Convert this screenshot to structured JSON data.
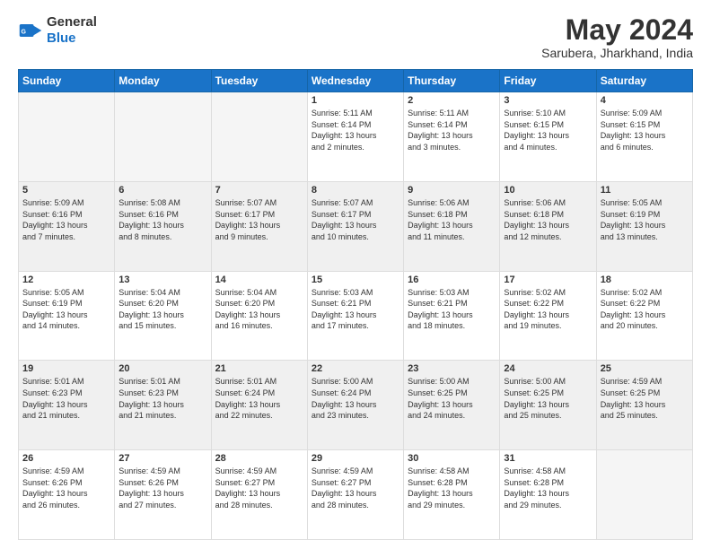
{
  "header": {
    "logo_general": "General",
    "logo_blue": "Blue",
    "month_year": "May 2024",
    "location": "Sarubera, Jharkhand, India"
  },
  "days_of_week": [
    "Sunday",
    "Monday",
    "Tuesday",
    "Wednesday",
    "Thursday",
    "Friday",
    "Saturday"
  ],
  "weeks": [
    [
      {
        "day": "",
        "info": ""
      },
      {
        "day": "",
        "info": ""
      },
      {
        "day": "",
        "info": ""
      },
      {
        "day": "1",
        "info": "Sunrise: 5:11 AM\nSunset: 6:14 PM\nDaylight: 13 hours\nand 2 minutes."
      },
      {
        "day": "2",
        "info": "Sunrise: 5:11 AM\nSunset: 6:14 PM\nDaylight: 13 hours\nand 3 minutes."
      },
      {
        "day": "3",
        "info": "Sunrise: 5:10 AM\nSunset: 6:15 PM\nDaylight: 13 hours\nand 4 minutes."
      },
      {
        "day": "4",
        "info": "Sunrise: 5:09 AM\nSunset: 6:15 PM\nDaylight: 13 hours\nand 6 minutes."
      }
    ],
    [
      {
        "day": "5",
        "info": "Sunrise: 5:09 AM\nSunset: 6:16 PM\nDaylight: 13 hours\nand 7 minutes."
      },
      {
        "day": "6",
        "info": "Sunrise: 5:08 AM\nSunset: 6:16 PM\nDaylight: 13 hours\nand 8 minutes."
      },
      {
        "day": "7",
        "info": "Sunrise: 5:07 AM\nSunset: 6:17 PM\nDaylight: 13 hours\nand 9 minutes."
      },
      {
        "day": "8",
        "info": "Sunrise: 5:07 AM\nSunset: 6:17 PM\nDaylight: 13 hours\nand 10 minutes."
      },
      {
        "day": "9",
        "info": "Sunrise: 5:06 AM\nSunset: 6:18 PM\nDaylight: 13 hours\nand 11 minutes."
      },
      {
        "day": "10",
        "info": "Sunrise: 5:06 AM\nSunset: 6:18 PM\nDaylight: 13 hours\nand 12 minutes."
      },
      {
        "day": "11",
        "info": "Sunrise: 5:05 AM\nSunset: 6:19 PM\nDaylight: 13 hours\nand 13 minutes."
      }
    ],
    [
      {
        "day": "12",
        "info": "Sunrise: 5:05 AM\nSunset: 6:19 PM\nDaylight: 13 hours\nand 14 minutes."
      },
      {
        "day": "13",
        "info": "Sunrise: 5:04 AM\nSunset: 6:20 PM\nDaylight: 13 hours\nand 15 minutes."
      },
      {
        "day": "14",
        "info": "Sunrise: 5:04 AM\nSunset: 6:20 PM\nDaylight: 13 hours\nand 16 minutes."
      },
      {
        "day": "15",
        "info": "Sunrise: 5:03 AM\nSunset: 6:21 PM\nDaylight: 13 hours\nand 17 minutes."
      },
      {
        "day": "16",
        "info": "Sunrise: 5:03 AM\nSunset: 6:21 PM\nDaylight: 13 hours\nand 18 minutes."
      },
      {
        "day": "17",
        "info": "Sunrise: 5:02 AM\nSunset: 6:22 PM\nDaylight: 13 hours\nand 19 minutes."
      },
      {
        "day": "18",
        "info": "Sunrise: 5:02 AM\nSunset: 6:22 PM\nDaylight: 13 hours\nand 20 minutes."
      }
    ],
    [
      {
        "day": "19",
        "info": "Sunrise: 5:01 AM\nSunset: 6:23 PM\nDaylight: 13 hours\nand 21 minutes."
      },
      {
        "day": "20",
        "info": "Sunrise: 5:01 AM\nSunset: 6:23 PM\nDaylight: 13 hours\nand 21 minutes."
      },
      {
        "day": "21",
        "info": "Sunrise: 5:01 AM\nSunset: 6:24 PM\nDaylight: 13 hours\nand 22 minutes."
      },
      {
        "day": "22",
        "info": "Sunrise: 5:00 AM\nSunset: 6:24 PM\nDaylight: 13 hours\nand 23 minutes."
      },
      {
        "day": "23",
        "info": "Sunrise: 5:00 AM\nSunset: 6:25 PM\nDaylight: 13 hours\nand 24 minutes."
      },
      {
        "day": "24",
        "info": "Sunrise: 5:00 AM\nSunset: 6:25 PM\nDaylight: 13 hours\nand 25 minutes."
      },
      {
        "day": "25",
        "info": "Sunrise: 4:59 AM\nSunset: 6:25 PM\nDaylight: 13 hours\nand 25 minutes."
      }
    ],
    [
      {
        "day": "26",
        "info": "Sunrise: 4:59 AM\nSunset: 6:26 PM\nDaylight: 13 hours\nand 26 minutes."
      },
      {
        "day": "27",
        "info": "Sunrise: 4:59 AM\nSunset: 6:26 PM\nDaylight: 13 hours\nand 27 minutes."
      },
      {
        "day": "28",
        "info": "Sunrise: 4:59 AM\nSunset: 6:27 PM\nDaylight: 13 hours\nand 28 minutes."
      },
      {
        "day": "29",
        "info": "Sunrise: 4:59 AM\nSunset: 6:27 PM\nDaylight: 13 hours\nand 28 minutes."
      },
      {
        "day": "30",
        "info": "Sunrise: 4:58 AM\nSunset: 6:28 PM\nDaylight: 13 hours\nand 29 minutes."
      },
      {
        "day": "31",
        "info": "Sunrise: 4:58 AM\nSunset: 6:28 PM\nDaylight: 13 hours\nand 29 minutes."
      },
      {
        "day": "",
        "info": ""
      }
    ]
  ],
  "gray_rows": [
    1,
    3
  ]
}
